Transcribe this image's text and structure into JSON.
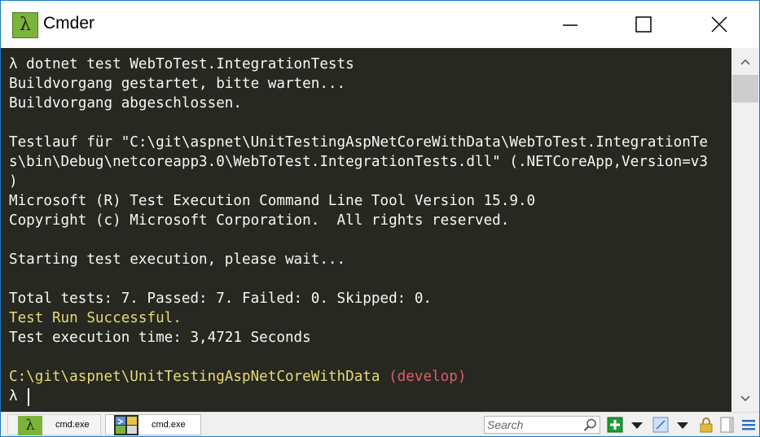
{
  "window": {
    "title": "Cmder",
    "icon_glyph": "λ",
    "controls": [
      "minimize-icon",
      "maximize-icon",
      "close-icon"
    ]
  },
  "console": {
    "lines": [
      "λ dotnet test WebToTest.IntegrationTests",
      "Buildvorgang gestartet, bitte warten...",
      "Buildvorgang abgeschlossen.",
      "",
      "Testlauf für \"C:\\git\\aspnet\\UnitTestingAspNetCoreWithData\\WebToTest.IntegrationTe",
      "s\\bin\\Debug\\netcoreapp3.0\\WebToTest.IntegrationTests.dll\" (.NETCoreApp,Version=v3",
      ")",
      "Microsoft (R) Test Execution Command Line Tool Version 15.9.0",
      "Copyright (c) Microsoft Corporation.  All rights reserved.",
      "",
      "Starting test execution, please wait...",
      "",
      "Total tests: 7. Passed: 7. Failed: 0. Skipped: 0.",
      "Test Run Successful.",
      "Test execution time: 3,4721 Seconds",
      ""
    ],
    "prompt_path": "C:\\git\\aspnet\\UnitTestingAspNetCoreWithData",
    "prompt_branch": "(develop)",
    "prompt_symbol": "λ",
    "colors": {
      "background": "#272822",
      "text": "#f8f8f2",
      "success": "#e6db74",
      "path": "#e6db74",
      "branch": "#e05b6a"
    }
  },
  "statusbar": {
    "tabs": [
      {
        "label": "cmd.exe",
        "icon": "lambda-icon",
        "active": false
      },
      {
        "label": "cmd.exe",
        "icon": "cmd-exe-icon",
        "active": true
      }
    ],
    "search": {
      "placeholder": "Search",
      "value": ""
    },
    "buttons": [
      "new-console-icon",
      "dropdown-arrow-icon",
      "console-view-icon",
      "dropdown-arrow-icon",
      "lock-icon",
      "scroll-mode-icon",
      "menu-icon"
    ]
  }
}
